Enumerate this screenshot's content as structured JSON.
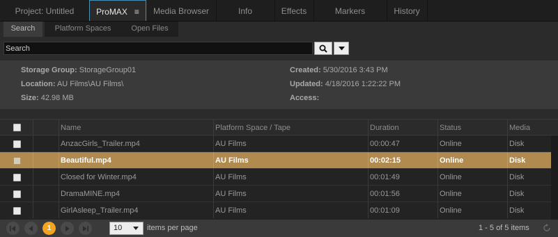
{
  "tabs": [
    {
      "label": "Project: Untitled"
    },
    {
      "label": "ProMAX"
    },
    {
      "label": "Media Browser"
    },
    {
      "label": "Info"
    },
    {
      "label": "Effects"
    },
    {
      "label": "Markers"
    },
    {
      "label": "History"
    }
  ],
  "subtabs": [
    {
      "label": "Search"
    },
    {
      "label": "Platform Spaces"
    },
    {
      "label": "Open Files"
    }
  ],
  "search": {
    "placeholder": "Search"
  },
  "info": {
    "storage_group_label": "Storage Group:",
    "storage_group": "StorageGroup01",
    "location_label": "Location:",
    "location": "AU Films\\AU Films\\",
    "size_label": "Size:",
    "size": "42.98 MB",
    "created_label": "Created:",
    "created": "5/30/2016 3:43 PM",
    "updated_label": "Updated:",
    "updated": "4/18/2016 1:22:22 PM",
    "access_label": "Access:",
    "access": ""
  },
  "table": {
    "headers": {
      "name": "Name",
      "platform": "Platform Space / Tape",
      "duration": "Duration",
      "status": "Status",
      "media": "Media"
    },
    "rows": [
      {
        "name": "AnzacGirls_Trailer.mp4",
        "platform": "AU Films",
        "duration": "00:00:47",
        "status": "Online",
        "media": "Disk"
      },
      {
        "name": "Beautiful.mp4",
        "platform": "AU Films",
        "duration": "00:02:15",
        "status": "Online",
        "media": "Disk"
      },
      {
        "name": "Closed for Winter.mp4",
        "platform": "AU Films",
        "duration": "00:01:49",
        "status": "Online",
        "media": "Disk"
      },
      {
        "name": "DramaMINE.mp4",
        "platform": "AU Films",
        "duration": "00:01:56",
        "status": "Online",
        "media": "Disk"
      },
      {
        "name": "GirlAsleep_Trailer.mp4",
        "platform": "AU Films",
        "duration": "00:01:09",
        "status": "Online",
        "media": "Disk"
      }
    ],
    "selected_row_color": "#b08a4e"
  },
  "pagination": {
    "current_page": "1",
    "per_page": "10",
    "per_page_label": "items per page",
    "range": "1 - 5 of 5 items",
    "accent": "#f2a51e"
  },
  "icons": {
    "search": "magnifier-icon",
    "dropdown": "caret-down-icon",
    "panel_menu": "hamburger-icon",
    "refresh": "refresh-icon"
  }
}
